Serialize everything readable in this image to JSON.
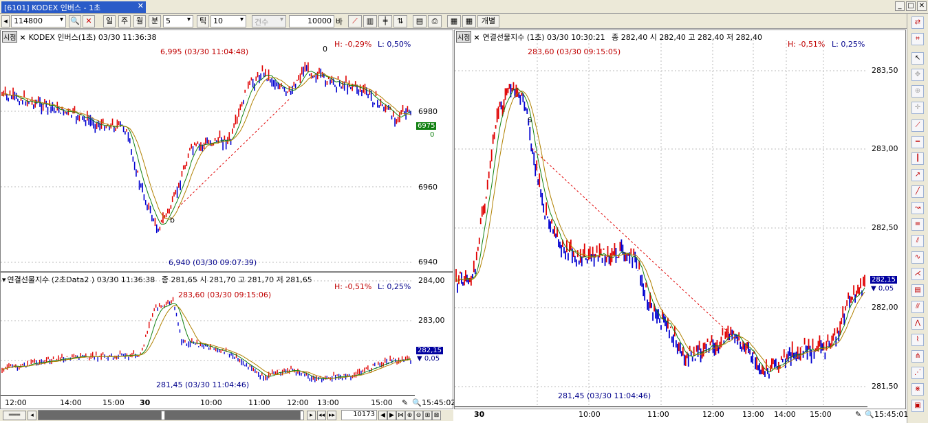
{
  "window": {
    "tab_title": "[6101] KODEX 인버스 - 1초",
    "close": "✕",
    "controls": [
      "_",
      "□",
      "✕"
    ]
  },
  "toolbar": {
    "code": "114800",
    "period_day": "일",
    "period_week": "주",
    "period_month": "월",
    "period_minute": "분",
    "interval_value": "5",
    "tick_label": "틱",
    "tick_value": "10",
    "count_label": "건수",
    "bar_count": "10000",
    "bar_unit": "바",
    "individual": "개별"
  },
  "left_top": {
    "badge": "시점",
    "title": "KODEX 인버스(1초) 03/30 11:36:38",
    "high_pct": "H: -0,29%",
    "low_pct": "L: 0,50%",
    "high_ann": "6,995 (03/30 11:04:48)",
    "low_ann": "6,940 (03/30 09:07:39)",
    "marker_o": "0",
    "marker_b": "b",
    "y_ticks": [
      "6980",
      "6960",
      "6940"
    ],
    "current_price": "6975",
    "current_change": "0"
  },
  "left_bottom": {
    "title": "연결선물지수 (2초Data2 ) 03/30 11:36:38",
    "ohlc": "종 281,65   시 281,70 고 281,70 저 281,65",
    "high_pct": "H: -0,51%",
    "low_pct": "L: 0,25%",
    "high_ann": "283,60 (03/30 09:15:06)",
    "low_ann": "281,45 (03/30 11:04:46)",
    "y_ticks": [
      "284,00",
      "283,00"
    ],
    "current_price": "282,15",
    "current_change": "0,05",
    "x_ticks": [
      "12:00",
      "14:00",
      "15:00",
      "30",
      "10:00",
      "11:00",
      "12:00",
      "13:00",
      "15:00"
    ],
    "time_end": "15:45:02"
  },
  "right": {
    "badge": "시점",
    "title": "연결선물지수 (1초) 03/30 10:30:21",
    "ohlc": "종 282,40   시 282,40 고 282,40 저 282,40",
    "high_pct": "H: -0,51%",
    "low_pct": "L: 0,25%",
    "high_ann": "283,60 (03/30 09:15:05)",
    "low_ann": "281,45 (03/30 11:04:46)",
    "marker_s": "S",
    "y_ticks": [
      "283,50",
      "283,00",
      "282,50",
      "282,00",
      "281,50"
    ],
    "current_price": "282,15",
    "current_change": "0,05",
    "x_ticks": [
      "30",
      "10:00",
      "11:00",
      "12:00",
      "13:00",
      "14:00",
      "15:00"
    ],
    "time_end": "15:45:01"
  },
  "bottom": {
    "bar_position": "10173"
  },
  "colors": {
    "up": "#e00000",
    "down": "#0000d0",
    "accent": "#2a5bc8"
  }
}
